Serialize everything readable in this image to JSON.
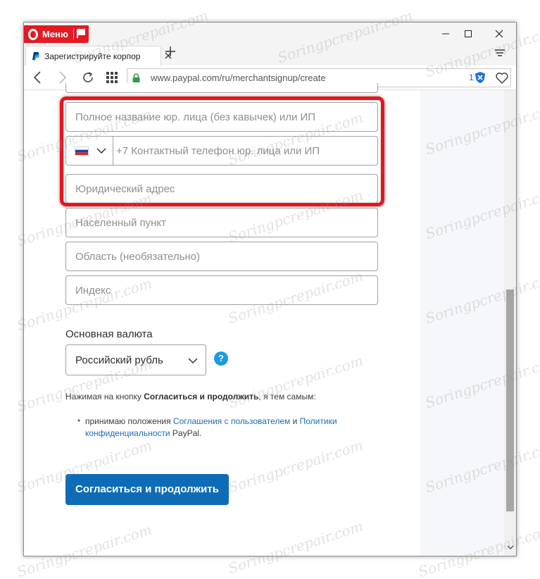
{
  "browser": {
    "menu_label": "Меню",
    "tab_title": "Зарегистрируйте корпор",
    "url": "www.paypal.com/ru/merchantsignup/create",
    "ad_block_count": "1"
  },
  "form": {
    "company_name_placeholder": "Полное название юр. лица (без кавычек) или ИП",
    "phone_placeholder": "+7 Контактный телефон юр. лица или ИП",
    "address_placeholder": "Юридический адрес",
    "city_placeholder": "Населенный пункт",
    "region_placeholder": "Область (необязательно)",
    "zip_placeholder": "Индекс",
    "currency_label": "Основная валюта",
    "currency_value": "Российский рубль",
    "help_glyph": "?",
    "terms_intro_prefix": "Нажимая на кнопку ",
    "terms_intro_button": "Согласиться и продолжить",
    "terms_intro_suffix": ", я тем самым:",
    "terms_item_prefix": "принимаю положения ",
    "terms_link_user_agreement": "Соглашения с пользователем",
    "terms_and": " и ",
    "terms_link_privacy": "Политики конфиденциальности",
    "terms_item_suffix": " PayPal.",
    "agree_button": "Согласиться и продолжить"
  },
  "watermark_text": "Soringpcrepair.com",
  "colors": {
    "opera_red": "#e11a24",
    "highlight": "#e8151d",
    "paypal_button": "#0e6cb6",
    "link": "#1a6cb8",
    "help_icon": "#1a9be0"
  }
}
